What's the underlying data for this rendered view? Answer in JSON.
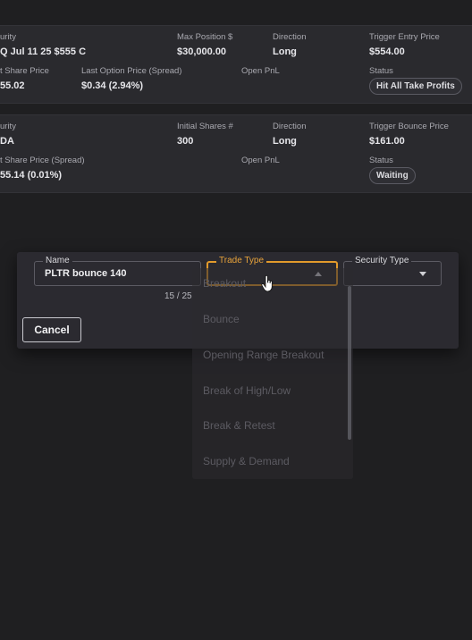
{
  "cards": [
    {
      "security_label": "urity",
      "security_value": "Q Jul 11 25 $555 C",
      "metric1_label": "Max Position $",
      "metric1_value": "$30,000.00",
      "direction_label": "Direction",
      "direction_value": "Long",
      "trigger_label": "Trigger Entry Price",
      "trigger_value": "$554.00",
      "share_label": "t Share Price",
      "share_value": "55.02",
      "option_label": "Last Option Price (Spread)",
      "option_value": "$0.34 (2.94%)",
      "pnl_label": "Open PnL",
      "status_label": "Status",
      "status_value": "Hit All Take Profits"
    },
    {
      "security_label": "urity",
      "security_value": "DA",
      "metric1_label": "Initial Shares #",
      "metric1_value": "300",
      "direction_label": "Direction",
      "direction_value": "Long",
      "trigger_label": "Trigger Bounce Price",
      "trigger_value": "$161.00",
      "share_label": "t Share Price (Spread)",
      "share_value": "55.14 (0.01%)",
      "pnl_label": "Open PnL",
      "status_label": "Status",
      "status_value": "Waiting"
    }
  ],
  "dialog": {
    "name_label": "Name",
    "name_value": "PLTR bounce 140",
    "name_counter": "15 / 25",
    "trade_type_label": "Trade Type",
    "security_type_label": "Security Type",
    "cancel_label": "Cancel"
  },
  "trade_type_options": [
    "Breakout",
    "Bounce",
    "Opening Range Breakout",
    "Break of High/Low",
    "Break & Retest",
    "Supply & Demand"
  ],
  "colors": {
    "accent": "#e29a2b",
    "background": "#1f1f21",
    "card": "#2a2a2e"
  }
}
